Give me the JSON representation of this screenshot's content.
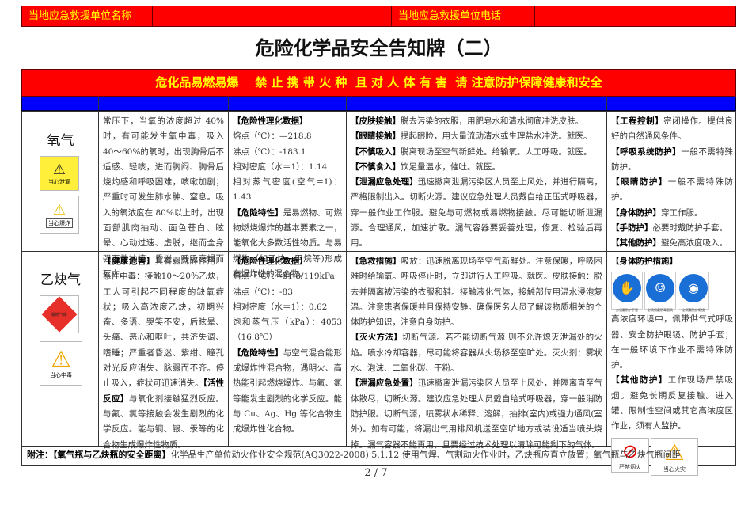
{
  "header": {
    "unit_name_label": "当地应急救援单位名称",
    "unit_name_value": "",
    "unit_phone_label": "当地应急救援单位电话",
    "unit_phone_value": ""
  },
  "title": "危险化学品安全告知牌（二）",
  "banner": "危化品易燃易爆    禁 止 携 带 火 种  且 对 人 体 有 害  请 注意防护保障健康和安全",
  "colors": {
    "red": "#ff0000",
    "blue": "#0000ff",
    "yellow": "#ffff00"
  },
  "oxygen": {
    "name": "氧气",
    "signs": [
      "当心泄漏",
      "当心爆炸"
    ],
    "health": "常压下，当氧的浓度超过 40%时，有可能发生氧中毒，吸入 40～60%的氧时，出现胸骨后不适感、轻咳，进而胸闷、胸骨后烧灼感和呼吸困难，咳嗽加剧；严重时可发生肺水肿、窒息。吸入的氧浓度在 80%以上时，出现面部肌肉抽动、面色苍白、眩晕、心动过速、虚脱，继而全身强直性抽搐、昏迷、呼吸衰竭而死亡。",
    "props_title": "【危险性理化数据】",
    "props": [
      "熔点（℃）：—218.8",
      "沸点（℃）：-183.1",
      "相对密度（水＝1）：1.14",
      "相对蒸气密度(空气=1)：1.43"
    ],
    "hazard_title": "【危险特性】",
    "hazard": "是易燃物、可燃物燃烧爆炸的基本要素之一， 能氧化大多数活性物质。与易燃物（如乙炔、甲烷等)形成有爆炸性的混合物。",
    "firstaid": [
      {
        "k": "【皮肤接触】",
        "v": "脱去污染的衣服，用肥皂水和清水彻底冲洗皮肤。"
      },
      {
        "k": "【眼睛接触】",
        "v": "提起眼睑，用大量流动清水或生理盐水冲洗。就医。"
      },
      {
        "k": "【不慎吸入】",
        "v": "脱离现场至空气新鲜处。给输氧。人工呼吸。就医。"
      },
      {
        "k": "【不慎食入】",
        "v": "饮足量温水，催吐。就医。"
      },
      {
        "k": "【泄漏应急处理】",
        "v": "迅速撤离泄漏污染区人员至上风处，并进行隔离，严格限制出入。切断火源。建议应急处理人员戴自给正压式呼吸器，穿一般作业工作服。避免与可燃物或易燃物接触。尽可能切断泄漏源。合理通风，加速扩散。漏气容器要妥善处理，修复、检验后再用。"
      }
    ],
    "protection": [
      {
        "k": "【工程控制】",
        "v": "密闭操作。提供良好的自然通风条件。"
      },
      {
        "k": "【呼吸系统防护】",
        "v": "一般不需特殊防护。"
      },
      {
        "k": "【眼睛防护】",
        "v": "一般不需特殊防护。"
      },
      {
        "k": "【身体防护】",
        "v": "穿工作服。"
      },
      {
        "k": "【手防护】",
        "v": "必要时戴防护手套。"
      },
      {
        "k": "【其他防护】",
        "v": "避免高浓度吸入。"
      }
    ]
  },
  "acetylene": {
    "name": "乙炔气",
    "signs": [
      "易燃气体",
      "当心中毒"
    ],
    "health_title": "【健康危害】",
    "health": "具有弱麻醉作用。急性中毒：接触10～20％乙炔，工人可引起不同程度的缺氧症状；吸入高浓度乙炔，初期兴奋、多语、哭笑不安，后眩晕、头痛、恶心和呕吐，共济失调、嗜睡；严重者昏迷、紫绀、瞳孔对光反应消失、脉弱而不齐。停止吸入，症状可迅速消失。",
    "reactive_title": "【活性反应】",
    "reactive": "与氧化剂接触猛烈反应。与氟、氯等接触会发生剧烈的化学反应。能与铜、银、汞等的化合物生成爆炸性物质。",
    "props_title": "【危险性理化数据】",
    "props": [
      "熔点（℃）：-81.8/119kPa",
      "沸点（℃）：-83",
      "相对密度（水＝1）：0.62",
      "饱和蒸气压（kPa）：4053（16.8℃）"
    ],
    "hazard_title": "【危险特性】",
    "hazard": "与空气混合能形成爆炸性混合物，遇明火、高热能引起燃烧爆炸。与氟、氯等能发生剧烈的化学反应。能与 Cu、Ag、Hg 等化合物生成爆炸性化合物。",
    "firstaid": [
      {
        "k": "【急救措施】",
        "v": "吸放：迅速脱离现场至空气新鲜处。注意保暖，呼吸困难时给输氧。呼吸停止时，立即进行人工呼吸。就医。皮肤接触：脱去并隔离被污染的衣服和鞋。接触液化气体，接触部位用温水浸泡复温。注意患者保暖并且保持安静。确保医务人员了解该物质相关的个体防护知识，注意自身防护。"
      },
      {
        "k": "【灭火方法】",
        "v": "切断气源。若不能切断气源 则不允许熄灭泄漏处的火焰。喷水冷却容器，尽可能将容器从火场移至空旷处。灭火剂：雾状水、泡沫、二氧化碳、干粉。"
      },
      {
        "k": "【泄漏应急处置】",
        "v": "迅速撤离泄漏污染区人员至上风处，并隔离直至气体散尽，切断火源。建议应急处理人员戴自给式呼吸器，穿一般消防防护服。切断气源，喷雾状水稀释、溶解，抽排(室内)或强力通风(室外)。如有可能，将漏出气用排风机送至空旷地方或装设适当喷头烧掉。漏气容器不能再用，且要经过技术处理以清除可能剩下的气体。"
      }
    ],
    "protection_title": "【身体防护措施】",
    "ppe_signs": [
      "必须戴防护手套",
      "必须佩戴防毒面具",
      "必须戴防护眼镜"
    ],
    "protection_text": "高浓度环境中，佩带供气式呼吸器、安全防护眼镜、防护手套；在一般环境下作业不需特殊防护。",
    "other_title": "【其他防护】",
    "other": "工作现场严禁吸烟。避免长期反复接触。进入罐、限制性空间或其它高浓度区作业，须有人监护。",
    "bottom_signs": [
      "严禁烟火",
      "当心火灾"
    ]
  },
  "footer": {
    "label": "附注：",
    "key": "【氧气瓶与乙炔瓶的安全距离】",
    "text": "化学品生产单位动火作业安全规范(AQ3022-2008) 5.1.12 使用气焊、气割动火作业时，乙炔瓶应直立放置；氧气瓶与乙炔气瓶间距"
  },
  "page": "2 / 7"
}
